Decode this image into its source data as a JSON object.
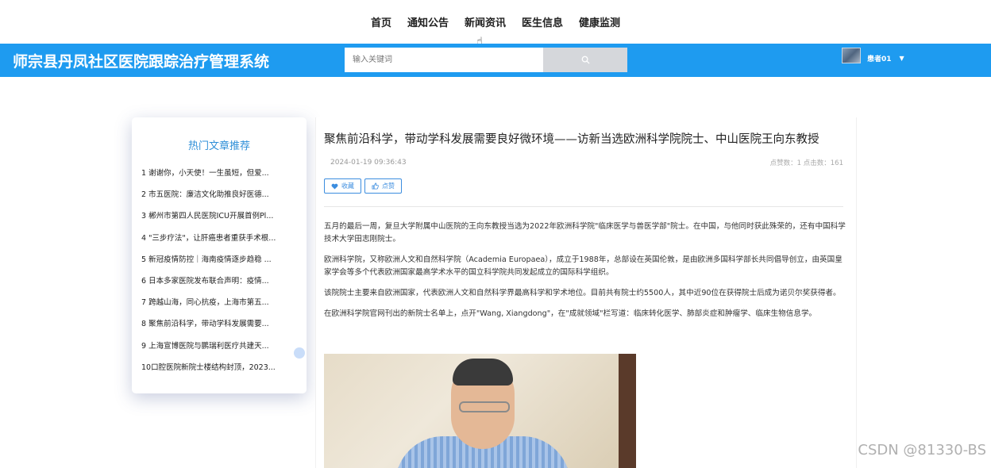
{
  "nav": {
    "items": [
      "首页",
      "通知公告",
      "新闻资讯",
      "医生信息",
      "健康监测"
    ]
  },
  "header": {
    "title": "师宗县丹凤社区医院跟踪治疗管理系统",
    "search_placeholder": "输入关键词",
    "search_icon": "search-icon",
    "user": {
      "name": "患者01",
      "caret_icon": "caret-down-icon"
    }
  },
  "sidebar": {
    "title": "热门文章推荐",
    "items": [
      "1 谢谢你，小天使！一生虽短，但爱...",
      "2 市五医院：廉洁文化助推良好医德...",
      "3 郴州市第四人民医院ICU开展首例Pl...",
      "4 \"三步疗法\"，让肝癌患者重获手术根...",
      "5 新冠疫情防控｜海南疫情逐步趋稳 ...",
      "6 日本多家医院发布联合声明：疫情...",
      "7 跨越山海，同心抗疫，上海市第五...",
      "8 聚焦前沿科学，带动学科发展需要...",
      "9 上海宣博医院与鹏瑞利医疗共建天...",
      "10口腔医院新院士楼结构封顶，2023..."
    ]
  },
  "article": {
    "title": "聚焦前沿科学，带动学科发展需要良好微环境——访新当选欧洲科学院院士、中山医院王向东教授",
    "date": "2024-01-19 09:36:43",
    "stats": "点赞数：1    点击数：161",
    "favorite_label": "收藏",
    "like_label": "点赞",
    "paragraphs": [
      "五月的最后一周，复旦大学附属中山医院的王向东教授当选为2022年欧洲科学院\"临床医学与兽医学部\"院士。在中国，与他同时获此殊荣的，还有中国科学技术大学田志刚院士。",
      "欧洲科学院，又称欧洲人文和自然科学院（Academia Europaea），成立于1988年，总部设在英国伦敦，是由欧洲多国科学部长共同倡导创立，由英国皇家学会等多个代表欧洲国家最高学术水平的国立科学院共同发起成立的国际科学组织。",
      "该院院士主要来自欧洲国家，代表欧洲人文和自然科学界最高科学和学术地位。目前共有院士约5500人，其中近90位在获得院士后成为诺贝尔奖获得者。",
      "在欧洲科学院官网刊出的新院士名单上，点开\"Wang, Xiangdong\"，在\"成就领域\"栏写道：临床转化医学、肺部炎症和肿瘤学、临床生物信息学。"
    ]
  },
  "watermark": "CSDN @81330-BS"
}
